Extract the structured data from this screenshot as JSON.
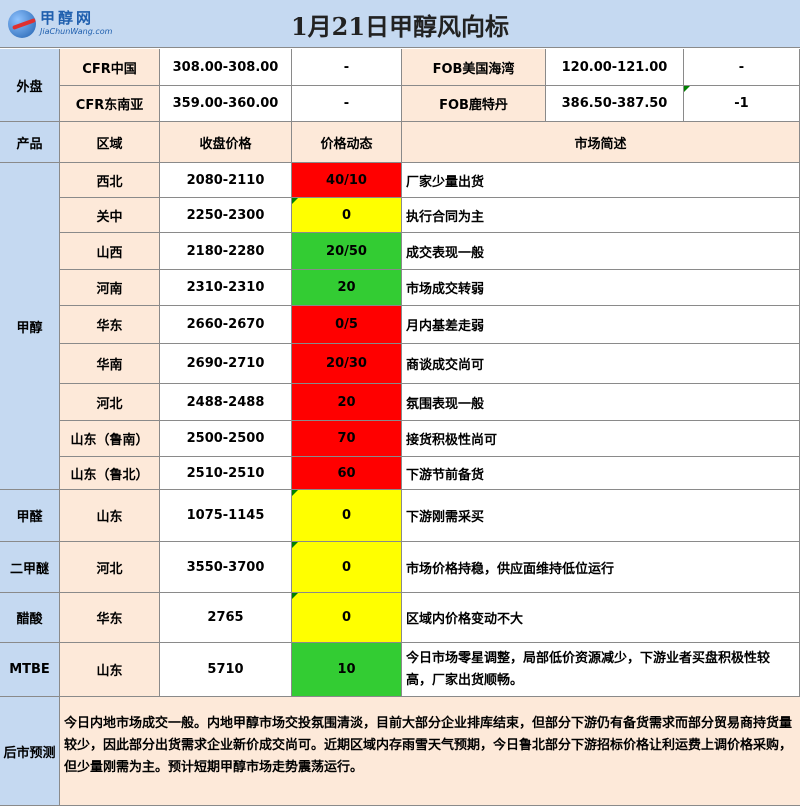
{
  "title": "1月21日甲醇风向标",
  "logo": {
    "cn": "甲醇网",
    "en": "JiaChunWang.com"
  },
  "external": {
    "label": "外盘",
    "rows": [
      {
        "name1": "CFR中国",
        "price1": "308.00-308.00",
        "change1": "-",
        "name2": "FOB美国海湾",
        "price2": "120.00-121.00",
        "change2": "-"
      },
      {
        "name1": "CFR东南亚",
        "price1": "359.00-360.00",
        "change1": "-",
        "name2": "FOB鹿特丹",
        "price2": "386.50-387.50",
        "change2": "-1"
      }
    ]
  },
  "headers": {
    "product": "产品",
    "region": "区域",
    "price": "收盘价格",
    "change": "价格动态",
    "summary": "市场简述"
  },
  "products": {
    "methanol": "甲醇",
    "formaldehyde": "甲醛",
    "dme": "二甲醚",
    "acetic": "醋酸",
    "mtbe": "MTBE"
  },
  "rows": [
    {
      "region": "西北",
      "price": "2080-2110",
      "change": "40/10",
      "status": "red",
      "summary": "厂家少量出货"
    },
    {
      "region": "关中",
      "price": "2250-2300",
      "change": "0",
      "status": "yellow",
      "summary": "执行合同为主"
    },
    {
      "region": "山西",
      "price": "2180-2280",
      "change": "20/50",
      "status": "green",
      "summary": "成交表现一般"
    },
    {
      "region": "河南",
      "price": "2310-2310",
      "change": "20",
      "status": "green",
      "summary": "市场成交转弱"
    },
    {
      "region": "华东",
      "price": "2660-2670",
      "change": "0/5",
      "status": "red",
      "summary": "月内基差走弱"
    },
    {
      "region": "华南",
      "price": "2690-2710",
      "change": "20/30",
      "status": "red",
      "summary": "商谈成交尚可"
    },
    {
      "region": "河北",
      "price": "2488-2488",
      "change": "20",
      "status": "red",
      "summary": "氛围表现一般"
    },
    {
      "region": "山东（鲁南）",
      "price": "2500-2500",
      "change": "70",
      "status": "red",
      "summary": "接货积极性尚可"
    },
    {
      "region": "山东（鲁北）",
      "price": "2510-2510",
      "change": "60",
      "status": "red",
      "summary": "下游节前备货"
    },
    {
      "region": "山东",
      "price": "1075-1145",
      "change": "0",
      "status": "yellow",
      "summary": "下游刚需采买"
    },
    {
      "region": "河北",
      "price": "3550-3700",
      "change": "0",
      "status": "yellow",
      "summary": "市场价格持稳，供应面维持低位运行"
    },
    {
      "region": "华东",
      "price": "2765",
      "change": "0",
      "status": "yellow",
      "summary": "区域内价格变动不大"
    },
    {
      "region": "山东",
      "price": "5710",
      "change": "10",
      "status": "green",
      "summary": "今日市场零星调整，局部低价资源减少，下游业者买盘积极性较高，厂家出货顺畅。"
    }
  ],
  "forecast": {
    "label": "后市预测",
    "text": "今日内地市场成交一般。内地甲醇市场交投氛围清淡，目前大部分企业排库结束，但部分下游仍有备货需求而部分贸易商持货量较少，因此部分出货需求企业新价成交尚可。近期区域内存雨雪天气预期，今日鲁北部分下游招标价格让利运费上调价格采购，但少量刚需为主。预计短期甲醇市场走势震荡运行。"
  },
  "colors": {
    "red": "#ff0000",
    "yellow": "#ffff00",
    "green": "#33cc33",
    "blue": "#c5d9f1",
    "tan": "#fde9d9"
  }
}
